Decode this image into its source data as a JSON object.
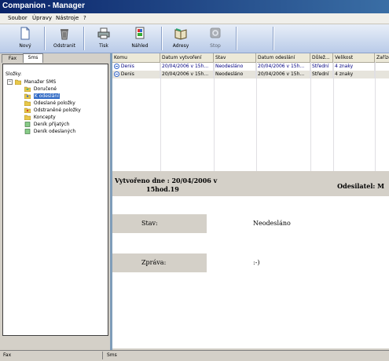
{
  "window": {
    "title": "Companion - Manager"
  },
  "menu": [
    "Soubor",
    "Úpravy",
    "Nástroje",
    "?"
  ],
  "toolbar": {
    "buttons": [
      {
        "label": "Nový",
        "icon": "new-document-icon"
      },
      {
        "label": "Odstranit",
        "icon": "trash-icon"
      },
      {
        "label": "Tisk",
        "icon": "printer-icon"
      },
      {
        "label": "Náhled",
        "icon": "preview-icon"
      },
      {
        "label": "Adresy",
        "icon": "address-book-icon"
      },
      {
        "label": "Stop",
        "icon": "stop-icon"
      }
    ]
  },
  "tabs": [
    "Fax",
    "Sms"
  ],
  "folders": {
    "title": "Složky:",
    "root": "Manažer SMS",
    "items": [
      "Doručené",
      "K odeslání",
      "Odeslané položky",
      "Odstraněné položky",
      "Koncepty",
      "Deník přijatých",
      "Deník odeslaných"
    ],
    "selected": "K odeslání"
  },
  "grid": {
    "columns": [
      "Komu",
      "Datum vytvoření",
      "Stav",
      "Datum odeslání",
      "Důlež...",
      "Velikost",
      "Zařízení"
    ],
    "rows": [
      [
        "Denis",
        "20/04/2006 v 15h...",
        "Neodesláno",
        "20/04/2006 v 15h...",
        "Střední",
        "4 znaky",
        ""
      ],
      [
        "Denis",
        "20/04/2006 v 15h...",
        "Neodesláno",
        "20/04/2006 v 15h...",
        "Střední",
        "4 znaky",
        ""
      ]
    ]
  },
  "detail": {
    "created_line1": "Vytvořeno dne : 20/04/2006 v",
    "created_line2": "15hod.19",
    "sender": "Odesilatel: M",
    "status_label": "Stav:",
    "status_value": "Neodesláno",
    "message_label": "Zpráva:",
    "message_value": ":-)"
  },
  "statusbar": {
    "left": "Fax",
    "right": "Sms"
  },
  "colors": {
    "titlebar": "#0a246a",
    "toolbar": "#c5d5ee",
    "selection": "#316ac5",
    "accent": "#7f9db9"
  }
}
